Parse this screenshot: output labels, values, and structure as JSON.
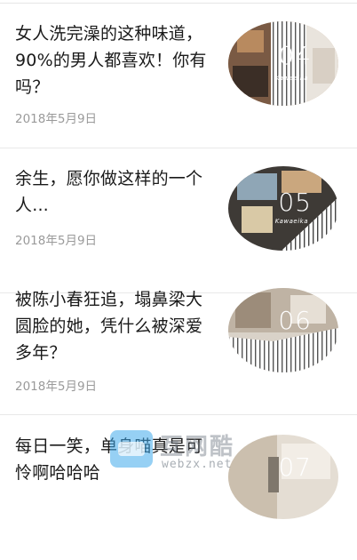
{
  "articles": [
    {
      "title_lines": [
        "女人洗完澡的这种味道，",
        "90%的男人都喜欢！你有",
        "吗？"
      ],
      "date": "2018年5月9日",
      "thumb_number": "04",
      "thumb_tag": "Kawaeika"
    },
    {
      "title_lines": [
        "余生，愿你做这样的一个",
        "人..."
      ],
      "date": "2018年5月9日",
      "thumb_number": "05",
      "thumb_tag": "Kawaeika"
    },
    {
      "title_lines": [
        "被陈小春狂追，塌鼻梁大",
        "圆脸的她，凭什么被深爱",
        "多年？"
      ],
      "date": "2018年5月9日",
      "thumb_number": "06",
      "thumb_tag": ""
    },
    {
      "title_lines": [
        "每日一笑，单身喵真是可",
        "怜啊哈哈哈"
      ],
      "date": "",
      "thumb_number": "07",
      "thumb_tag": ""
    }
  ],
  "watermark": {
    "brand": "互网酷",
    "domain": "webzx.net"
  }
}
